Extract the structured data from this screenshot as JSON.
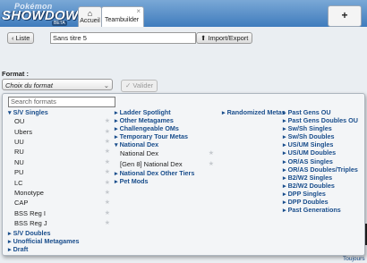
{
  "header": {
    "logo_top": "Pokémon",
    "logo_main": "SHOWDOWN!",
    "logo_badge": "BETA",
    "tabs": [
      {
        "icon": "home-icon",
        "glyph": "⌂",
        "label": "Accueil"
      },
      {
        "label": "Teambuilder",
        "close": "×"
      }
    ],
    "new_tab": "+"
  },
  "toolbar": {
    "liste_label": "‹ Liste",
    "team_name": "Sans titre 5",
    "import_label": "⬆ Import/Export"
  },
  "format": {
    "label": "Format :",
    "selected": "Choix du format",
    "caret": "⌄",
    "validate_label": "✓ Valider"
  },
  "popup": {
    "search_placeholder": "Search formats",
    "columns": [
      [
        {
          "section": "▾ S/V Singles",
          "formats": [
            "OU",
            "Ubers",
            "UU",
            "RU",
            "NU",
            "PU",
            "LC",
            "Monotype",
            "CAP",
            "BSS Reg I",
            "BSS Reg J"
          ]
        },
        {
          "section": "▸ S/V Doubles"
        },
        {
          "section": "▸ Unofficial Metagames"
        },
        {
          "section": "▸ Draft"
        }
      ],
      [
        {
          "section": "▸ Ladder Spotlight"
        },
        {
          "section": "▸ Other Metagames"
        },
        {
          "section": "▸ Challengeable OMs"
        },
        {
          "section": "▸ Temporary Tour Metas"
        },
        {
          "section": "▾ National Dex",
          "formats": [
            "National Dex",
            "[Gen 8] National Dex"
          ]
        },
        {
          "section": "▸ National Dex Other Tiers"
        },
        {
          "section": "▸ Pet Mods"
        }
      ],
      [
        {
          "section": "▸ Randomized Metas"
        }
      ],
      [
        {
          "section": "▸ Past Gens OU"
        },
        {
          "section": "▸ Past Gens Doubles OU"
        },
        {
          "section": "▸ Sw/Sh Singles"
        },
        {
          "section": "▸ Sw/Sh Doubles"
        },
        {
          "section": "▸ US/UM Singles"
        },
        {
          "section": "▸ US/UM Doubles"
        },
        {
          "section": "▸ OR/AS Singles"
        },
        {
          "section": "▸ OR/AS Doubles/Triples"
        },
        {
          "section": "▸ B2/W2 Singles"
        },
        {
          "section": "▸ B2/W2 Doubles"
        },
        {
          "section": "▸ DPP Singles"
        },
        {
          "section": "▸ DPP Doubles"
        },
        {
          "section": "▸ Past Generations"
        }
      ]
    ]
  },
  "footer": {
    "toujours": "Toujours"
  },
  "colors": {
    "header_top": "#7aa8d6",
    "header_bottom": "#3f7cbd",
    "section_link": "#1a4e8c",
    "panel": "#eaeef2"
  }
}
